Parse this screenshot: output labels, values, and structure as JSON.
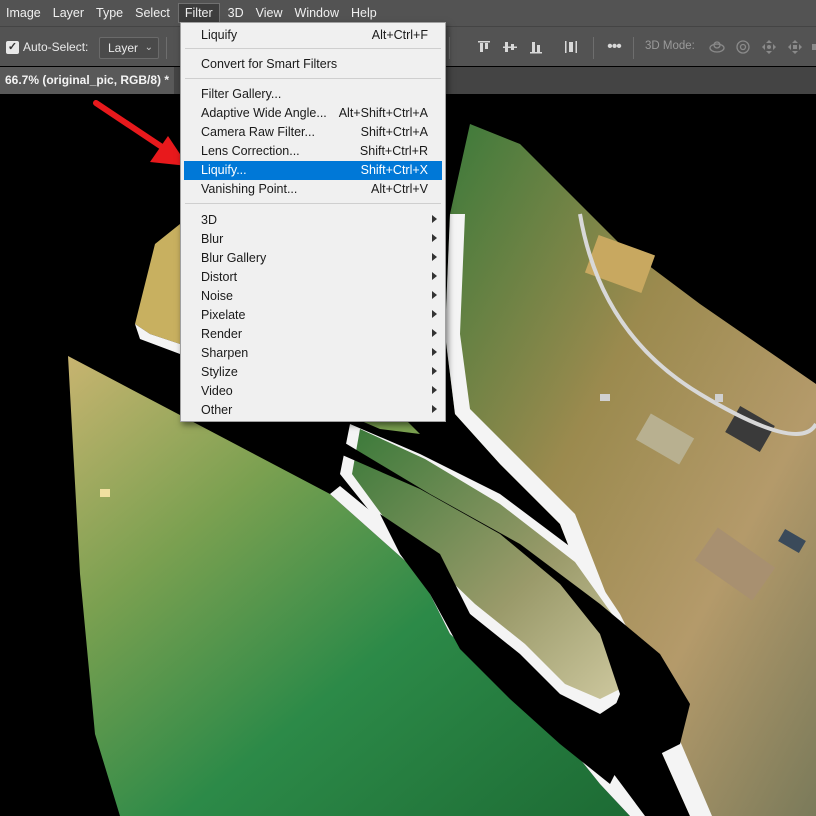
{
  "menubar": {
    "items": [
      "Image",
      "Layer",
      "Type",
      "Select",
      "Filter",
      "3D",
      "View",
      "Window",
      "Help"
    ]
  },
  "options": {
    "auto_select_label": "Auto-Select:",
    "auto_select_checked": true,
    "layer_dropdown": "Layer",
    "mode_3d_label": "3D Mode:"
  },
  "document": {
    "tab_title": "66.7% (original_pic, RGB/8) *"
  },
  "filter_menu": {
    "last_filter": {
      "label": "Liquify",
      "shortcut": "Alt+Ctrl+F"
    },
    "convert": {
      "label": "Convert for Smart Filters"
    },
    "filters": [
      {
        "label": "Filter Gallery...",
        "shortcut": ""
      },
      {
        "label": "Adaptive Wide Angle...",
        "shortcut": "Alt+Shift+Ctrl+A"
      },
      {
        "label": "Camera Raw Filter...",
        "shortcut": "Shift+Ctrl+A"
      },
      {
        "label": "Lens Correction...",
        "shortcut": "Shift+Ctrl+R"
      },
      {
        "label": "Liquify...",
        "shortcut": "Shift+Ctrl+X",
        "highlighted": true
      },
      {
        "label": "Vanishing Point...",
        "shortcut": "Alt+Ctrl+V"
      }
    ],
    "submenus": [
      "3D",
      "Blur",
      "Blur Gallery",
      "Distort",
      "Noise",
      "Pixelate",
      "Render",
      "Sharpen",
      "Stylize",
      "Video",
      "Other"
    ]
  },
  "colors": {
    "highlight": "#0078d7",
    "annotation_arrow": "#e8191c"
  }
}
